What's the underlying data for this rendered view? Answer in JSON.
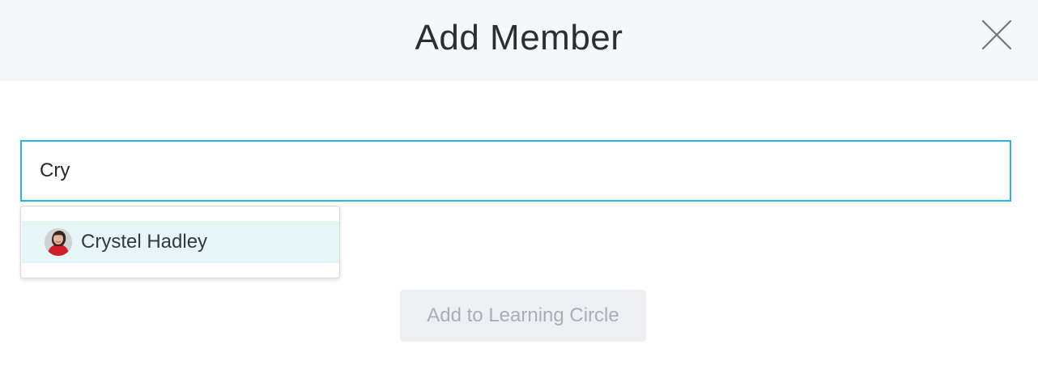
{
  "modal": {
    "title": "Add Member",
    "close_icon": "close-icon"
  },
  "search": {
    "value": "Cry",
    "placeholder": ""
  },
  "suggestions": [
    {
      "name": "Crystel Hadley",
      "avatar_icon": "user-avatar"
    }
  ],
  "actions": {
    "add_label": "Add to Learning Circle",
    "add_enabled": false
  },
  "colors": {
    "accent": "#22b7e0",
    "header_bg": "#f6f7f9",
    "highlight_bg": "#e6f5f5",
    "disabled_button_bg": "#eeeff2",
    "disabled_button_text": "#a8aeb8"
  }
}
